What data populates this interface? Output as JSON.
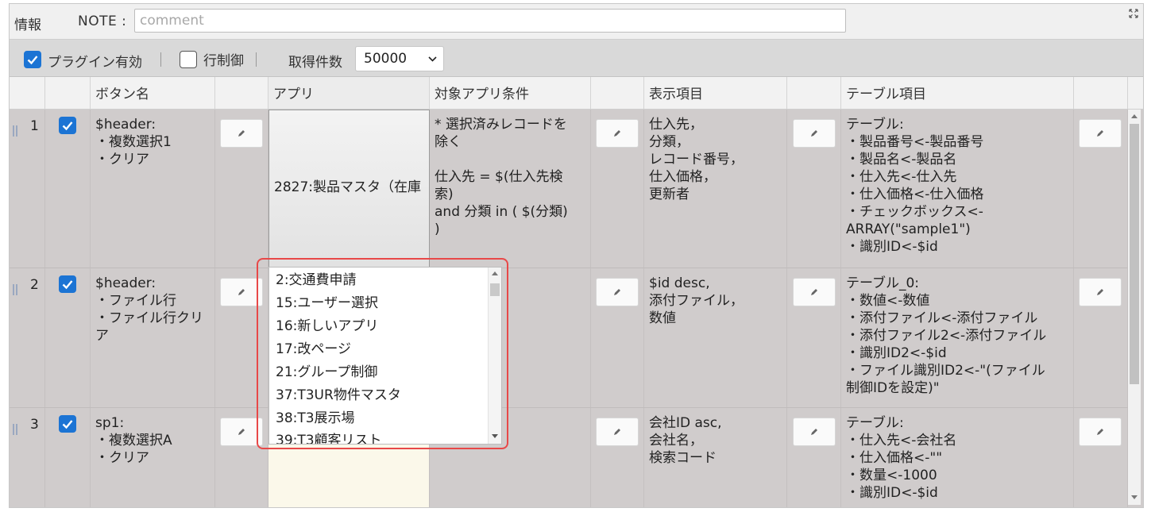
{
  "topbar": {
    "info_label": "情報",
    "note_label": "NOTE :",
    "note_placeholder": "comment",
    "note_value": ""
  },
  "toolbar": {
    "plugin_enabled_label": "プラグイン有効",
    "plugin_enabled": true,
    "row_control_label": "行制御",
    "row_control": false,
    "fetch_count_label": "取得件数",
    "fetch_count_value": "50000"
  },
  "columns": [
    "ボタン名",
    "アプリ",
    "対象アプリ条件",
    "表示項目",
    "テーブル項目"
  ],
  "rows": [
    {
      "num": "1",
      "checked": true,
      "button_name": "$header:\n・複数選択1\n・クリア",
      "app": "2827:製品マスタ（在庫",
      "condition": "* 選択済みレコードを\n除く\n\n仕入先 = $(仕入先検\n索)\nand 分類 in ( $(分類)\n)",
      "display_items": "仕入先，\n分類，\nレコード番号，\n仕入価格，\n更新者",
      "table_items": "テーブル:\n・製品番号<-製品番号\n・製品名<-製品名\n・仕入先<-仕入先\n・仕入価格<-仕入価格\n・チェックボックス<-\nARRAY(\"sample1\")\n・識別ID<-$id"
    },
    {
      "num": "2",
      "checked": true,
      "button_name": "$header:\n・ファイル行\n・ファイル行クリ\nア",
      "app": "",
      "condition": "",
      "display_items": "$id desc,\n添付ファイル，\n数値",
      "table_items": "テーブル_0:\n・数値<-数値\n・添付ファイル<-添付ファイル\n・添付ファイル2<-添付ファイル\n・識別ID2<-$id\n・ファイル識別ID2<-\"(ファイル\n制御IDを設定)\""
    },
    {
      "num": "3",
      "checked": true,
      "button_name": "sp1:\n・複数選択A\n・クリア",
      "app": "",
      "condition": "",
      "display_items": "会社ID asc,\n会社名，\n検索コード",
      "table_items": "テーブル:\n・仕入先<-会社名\n・仕入価格<-\"\"\n・数量<-1000\n・識別ID<-$id"
    }
  ],
  "app_dropdown": {
    "options": [
      "2:交通費申請",
      "15:ユーザー選択",
      "16:新しいアプリ",
      "17:改ページ",
      "21:グループ制御",
      "37:T3UR物件マスタ",
      "38:T3展示場",
      "39:T3顧客リスト"
    ]
  },
  "colors": {
    "accent": "#1c74d4",
    "highlight": "#e84848",
    "row_bg": "#d0cccc"
  }
}
